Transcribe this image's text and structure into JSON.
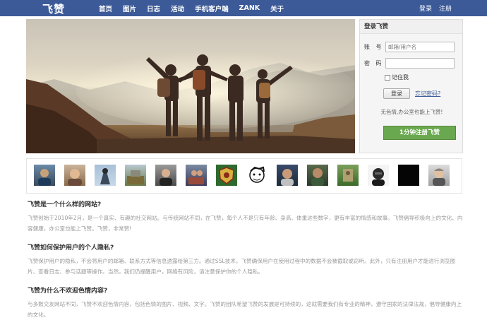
{
  "nav": {
    "logo": "飞赞",
    "items": [
      "首页",
      "图片",
      "日志",
      "活动",
      "手机客户端",
      "ZANK",
      "关于"
    ],
    "login": "登录",
    "register": "注册"
  },
  "login_box": {
    "title": "登录飞赞",
    "account_label": "账 号",
    "account_placeholder": "邮箱/用户名",
    "password_label": "密 码",
    "remember_label": "记住我",
    "login_button": "登录",
    "forgot_link": "忘记密码?",
    "slogan": "无色情,办公室也能上飞赞!",
    "register_button": "1分钟注册飞赞"
  },
  "faq": [
    {
      "question": "飞赞是一个什么样的网站?",
      "answer": "飞赞创始于2010年2月，是一个真实、有趣的社交网站。与传统网站不同，在飞赞，每个人不是只有年龄、身高、体重这些数字，更有丰富的情感和故事。飞赞倡导积极向上的文化、内容健康，办公室也能上飞赞。飞赞，非常赞!"
    },
    {
      "question": "飞赞如何保护用户的个人隐私?",
      "answer": "飞赞保护用户的隐私，不会将用户的邮箱、联系方式等信息透露给第三方。通过SSL技术，飞赞确保用户在使用过程中的数据不会被截取或窃听。此外，只有注册用户才能进行浏览图片、查看日志、参与话题等操作。当然，我们仍提醒用户，网络有风险，请注意保护你的个人隐私。"
    },
    {
      "question": "飞赞为什么不欢迎色情内容?",
      "answer": "与多数交友网站不同，飞赞不欢迎色情内容，包括色情的图片、视频、文字。飞赞的团队希望飞赞的发展是可持续的，这就需要我们有专业的精神，遵守国家的法律法规，倡导健康向上的文化。"
    }
  ]
}
